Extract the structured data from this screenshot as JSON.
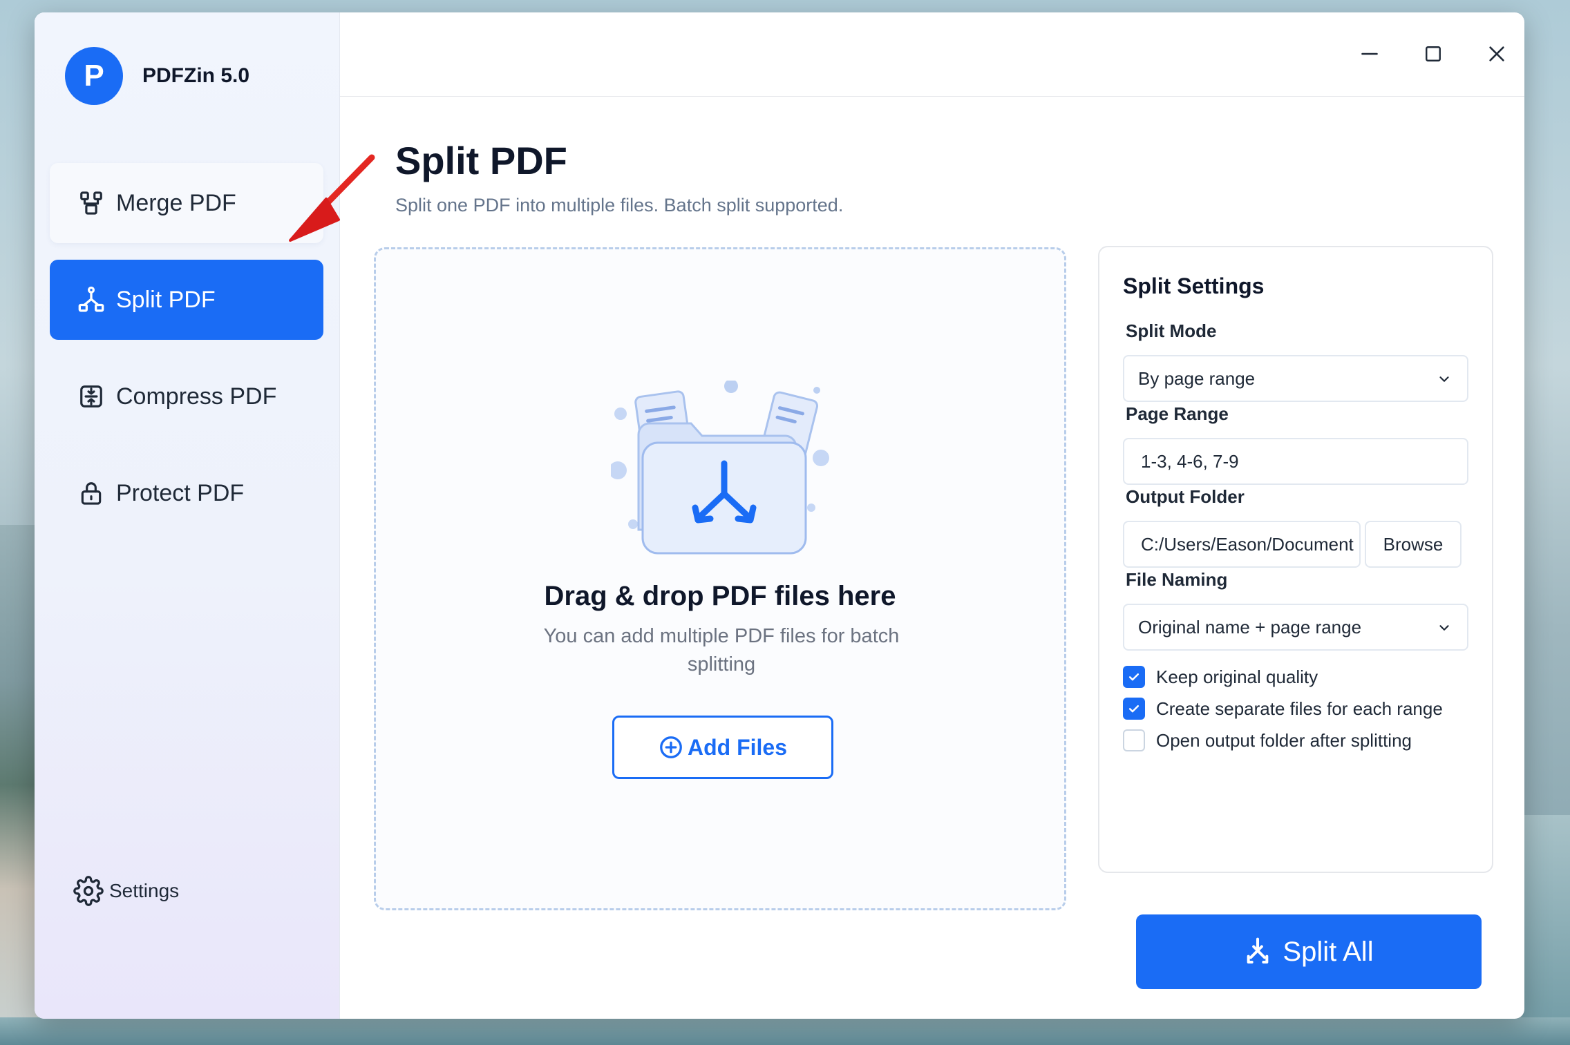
{
  "app": {
    "logo_letter": "P",
    "name": "PDFZin 5.0"
  },
  "sidebar": {
    "items": [
      {
        "label": "Merge PDF",
        "icon": "merge-icon",
        "state": "hover"
      },
      {
        "label": "Split PDF",
        "icon": "split-icon",
        "state": "active"
      },
      {
        "label": "Compress PDF",
        "icon": "compress-icon",
        "state": "normal"
      },
      {
        "label": "Protect PDF",
        "icon": "lock-icon",
        "state": "normal"
      }
    ],
    "settings_label": "Settings"
  },
  "window_controls": {
    "minimize": "minimize-icon",
    "maximize": "maximize-icon",
    "close": "close-icon"
  },
  "page": {
    "title": "Split PDF",
    "subtitle": "Split one PDF into multiple files. Batch split supported."
  },
  "dropzone": {
    "title": "Drag & drop PDF files here",
    "subtitle": "You can add multiple PDF files for batch splitting",
    "add_button": "Add Files"
  },
  "split_settings": {
    "title": "Split Settings",
    "split_mode": {
      "label": "Split Mode",
      "value": "By page range"
    },
    "page_range": {
      "label": "Page Range",
      "value": "1-3, 4-6, 7-9"
    },
    "output_folder": {
      "label": "Output Folder",
      "value": "C:/Users/Eason/Document",
      "browse_label": "Browse"
    },
    "file_naming": {
      "label": "File Naming",
      "value": "Original name + page range"
    },
    "options": [
      {
        "label": "Keep original quality",
        "checked": true
      },
      {
        "label": "Create separate files for each range",
        "checked": true
      },
      {
        "label": "Open output folder after splitting",
        "checked": false
      }
    ]
  },
  "actions": {
    "split_all": "Split All"
  },
  "colors": {
    "accent": "#1a6cf5",
    "annotation_arrow": "#e11d1d"
  }
}
